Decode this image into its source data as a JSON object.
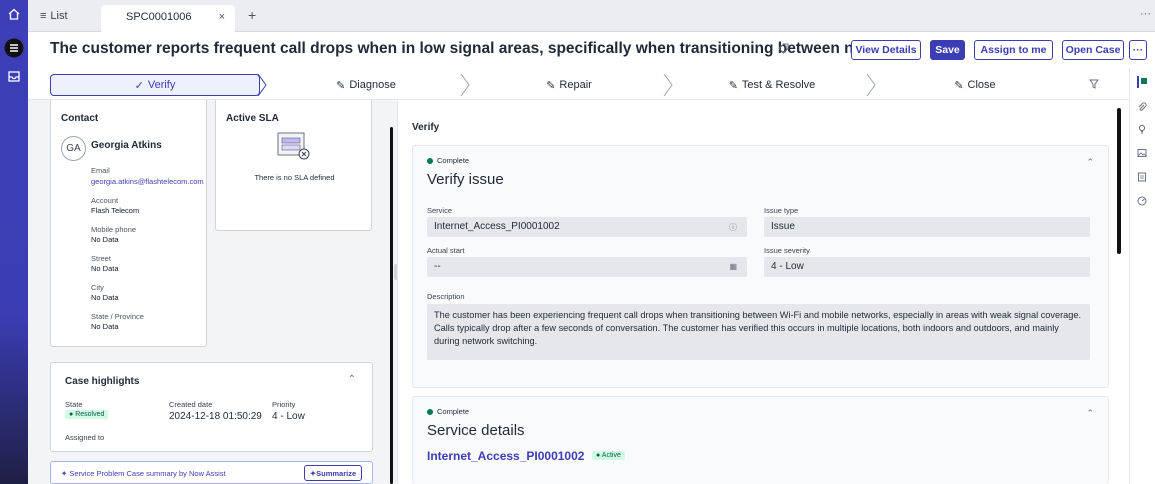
{
  "tabs": {
    "list_label": "List",
    "active_label": "SPC0001006",
    "close_glyph": "×",
    "add_glyph": "+",
    "more_glyph": "···"
  },
  "header": {
    "title": "The customer reports frequent call drops when in low signal areas, specifically when transitioning between networks.",
    "buttons": {
      "view_details": "View Details",
      "save": "Save",
      "assign_to_me": "Assign to me",
      "open_case": "Open Case",
      "more": "···"
    }
  },
  "stages": [
    {
      "label": "Verify",
      "state": "complete"
    },
    {
      "label": "Diagnose",
      "state": "pending"
    },
    {
      "label": "Repair",
      "state": "pending"
    },
    {
      "label": "Test & Resolve",
      "state": "pending"
    },
    {
      "label": "Close",
      "state": "pending"
    }
  ],
  "contact": {
    "heading": "Contact",
    "initials": "GA",
    "name": "Georgia Atkins",
    "fields": [
      {
        "label": "Email",
        "value": "georgia.atkins@flashtelecom.com",
        "link": true
      },
      {
        "label": "Account",
        "value": "Flash Telecom"
      },
      {
        "label": "Mobile phone",
        "value": "No Data"
      },
      {
        "label": "Street",
        "value": "No Data"
      },
      {
        "label": "City",
        "value": "No Data"
      },
      {
        "label": "State / Province",
        "value": "No Data"
      }
    ]
  },
  "sla": {
    "heading": "Active SLA",
    "empty_text": "There is no SLA defined"
  },
  "highlights": {
    "heading": "Case highlights",
    "state_label": "State",
    "state_value": "Resolved",
    "created_label": "Created date",
    "created_value": "2024-12-18 01:50:29",
    "priority_label": "Priority",
    "priority_value": "4 - Low",
    "assigned_label": "Assigned to"
  },
  "assist": {
    "text": "Service Problem Case summary by Now Assist",
    "button": "Summarize"
  },
  "panel": {
    "title": "Verify",
    "verify": {
      "status": "Complete",
      "heading": "Verify issue",
      "service_label": "Service",
      "service_value": "Internet_Access_PI0001002",
      "issue_type_label": "Issue type",
      "issue_type_value": "Issue",
      "actual_start_label": "Actual start",
      "actual_start_value": "--",
      "severity_label": "Issue severity",
      "severity_value": "4 - Low",
      "description_label": "Description",
      "description_value": "The customer has been experiencing frequent call drops when transitioning between Wi-Fi and mobile networks, especially in areas with weak signal coverage. Calls typically drop after a few seconds of conversation. The customer has verified this occurs in multiple locations, both indoors and outdoors, and mainly during network switching."
    },
    "service_details": {
      "status": "Complete",
      "heading": "Service details",
      "link": "Internet_Access_PI0001002",
      "badge": "Active"
    }
  },
  "colors": {
    "brand": "#3b3db3",
    "success": "#047857"
  }
}
